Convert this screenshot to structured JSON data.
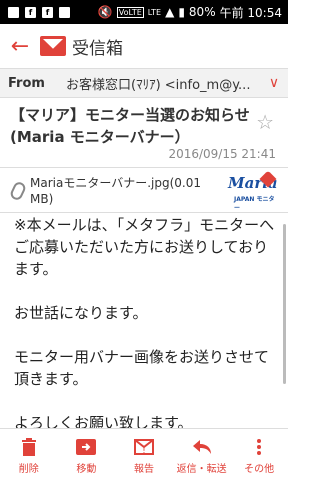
{
  "status_bar": {
    "left_icons": [
      "sim-card-icon",
      "facebook-icon",
      "facebook-icon",
      "image-icon"
    ],
    "volte": "VoLTE",
    "network": "LTE",
    "battery": "80%",
    "time": "午前 10:54"
  },
  "app_bar": {
    "title": "受信箱"
  },
  "from": {
    "label": "From",
    "value": "お客様窓口(ﾏﾘｱ) <info_m@y..."
  },
  "subject": "【マリア】モニター当選のお知らせ(Maria モニターバナー）",
  "date": "2016/09/15  21:41",
  "attachment": {
    "name": "Mariaモニターバナー.jpg(0.01 MB)",
    "logo_text": "Maria",
    "logo_sub": "JAPAN モニター"
  },
  "body": {
    "lines": [
      "※本メールは、「メタフラ」モニターへご応募いただいた方にお送りしております。",
      "お世話になります。",
      "モニター用バナー画像をお送りさせて頂きます。",
      "よろしくお願い致します。"
    ]
  },
  "bottom_bar": {
    "delete": "削除",
    "move": "移動",
    "report": "報告",
    "reply_forward": "返信・転送",
    "other": "その他"
  },
  "colors": {
    "accent": "#e0423a",
    "header_bg": "#f2f2f2"
  }
}
